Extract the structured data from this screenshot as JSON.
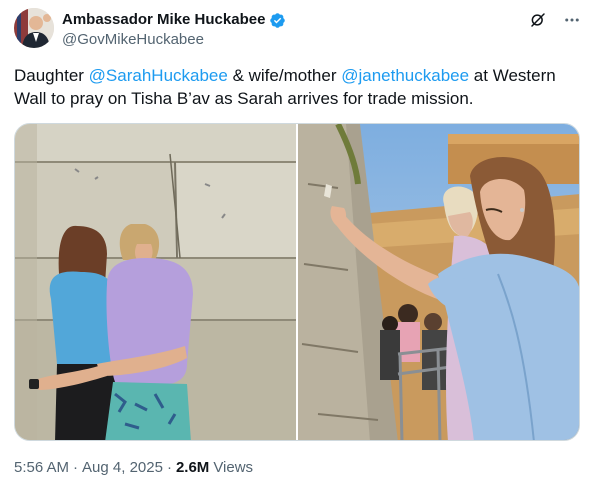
{
  "author": {
    "name": "Ambassador Mike Huckabee",
    "handle": "@GovMikeHuckabee",
    "verified": true,
    "verified_color": "#1d9bf0"
  },
  "tweet": {
    "text_parts": [
      {
        "type": "text",
        "value": "Daughter "
      },
      {
        "type": "mention",
        "value": "@SarahHuckabee"
      },
      {
        "type": "text",
        "value": " & wife/mother "
      },
      {
        "type": "mention",
        "value": "@janethuckabee"
      },
      {
        "type": "text",
        "value": " at Western Wall to pray on Tisha B’av as Sarah arrives for trade mission."
      }
    ],
    "link_color": "#1d9bf0"
  },
  "media": {
    "count": 2
  },
  "meta": {
    "time": "5:56 AM",
    "separator": "·",
    "date": "Aug 4, 2025",
    "views_count": "2.6M",
    "views_label": "Views"
  },
  "icons": {
    "grok": "grok-icon",
    "more": "more-options-icon",
    "verified": "verified-badge-icon"
  }
}
